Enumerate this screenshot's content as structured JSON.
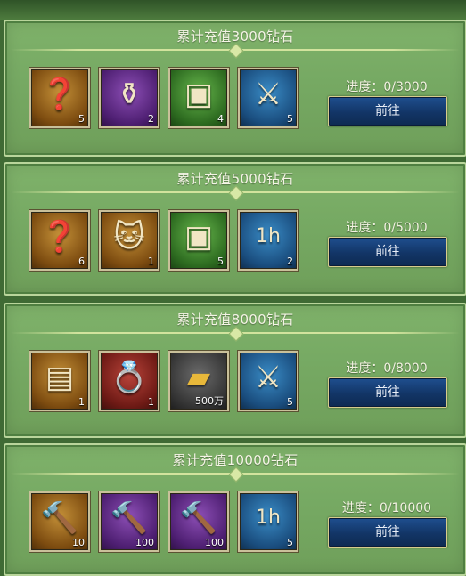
{
  "tiers": [
    {
      "title": "累计充值3000钻石",
      "progress": "进度：0/3000",
      "button_label": "前往",
      "rewards": [
        {
          "icon": "treasure-chest-mystery-icon",
          "glyph": "❓",
          "rarity": "orange",
          "count": "5"
        },
        {
          "icon": "golden-vase-icon",
          "glyph": "⚱",
          "rarity": "purple",
          "count": "2"
        },
        {
          "icon": "silver-chest-icon",
          "glyph": "▣",
          "rarity": "green",
          "count": "4"
        },
        {
          "icon": "crossed-swords-icon",
          "glyph": "⚔",
          "rarity": "blue",
          "count": "5"
        }
      ]
    },
    {
      "title": "累计充值5000钻石",
      "progress": "进度：0/5000",
      "button_label": "前往",
      "rewards": [
        {
          "icon": "treasure-chest-mystery-icon",
          "glyph": "❓",
          "rarity": "orange",
          "count": "6"
        },
        {
          "icon": "white-cat-icon",
          "glyph": "🐱",
          "rarity": "orange",
          "count": "1"
        },
        {
          "icon": "silver-chest-icon",
          "glyph": "▣",
          "rarity": "green",
          "count": "5"
        },
        {
          "icon": "hourglass-1h-speedup-icon",
          "glyph": "1h",
          "rarity": "blue",
          "count": "2"
        }
      ]
    },
    {
      "title": "累计充值8000钻石",
      "progress": "进度：0/8000",
      "button_label": "前往",
      "rewards": [
        {
          "icon": "golden-chest-icon",
          "glyph": "▤",
          "rarity": "orange",
          "count": "1"
        },
        {
          "icon": "sapphire-ring-icon",
          "glyph": "💍",
          "rarity": "red",
          "count": "1"
        },
        {
          "icon": "gold-bar-icon",
          "glyph": "▰",
          "rarity": "gray",
          "count": "500万"
        },
        {
          "icon": "crossed-swords-icon",
          "glyph": "⚔",
          "rarity": "blue",
          "count": "5"
        }
      ]
    },
    {
      "title": "累计充值10000钻石",
      "progress": "进度：0/10000",
      "button_label": "前往",
      "rewards": [
        {
          "icon": "war-hammer-icon",
          "glyph": "🔨",
          "rarity": "orange",
          "count": "10"
        },
        {
          "icon": "hammer-badge-icon",
          "glyph": "🔨",
          "rarity": "purple",
          "count": "100"
        },
        {
          "icon": "hammer-badge-icon",
          "glyph": "🔨",
          "rarity": "purple",
          "count": "100"
        },
        {
          "icon": "hourglass-1h-speedup-icon",
          "glyph": "1h",
          "rarity": "blue",
          "count": "5"
        }
      ]
    }
  ]
}
